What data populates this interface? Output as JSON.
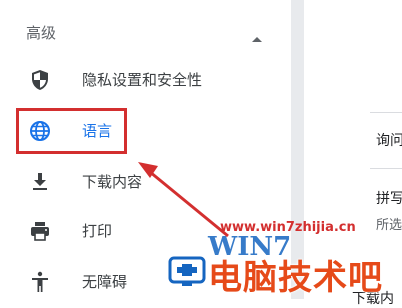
{
  "sidebar": {
    "section_title": "高级",
    "items": [
      {
        "label": "隐私设置和安全性",
        "icon": "shield-icon"
      },
      {
        "label": "语言",
        "icon": "globe-icon"
      },
      {
        "label": "下载内容",
        "icon": "download-icon"
      },
      {
        "label": "打印",
        "icon": "printer-icon"
      },
      {
        "label": "无障碍",
        "icon": "accessibility-icon"
      }
    ]
  },
  "content": {
    "row1": "询问",
    "row2": "拼写",
    "row2_sub": "所选",
    "row3": "下载内"
  },
  "watermark": {
    "url": "www.win7zhijia.cn",
    "logo": "WIN7",
    "brand": "电脑技术吧"
  },
  "colors": {
    "accent": "#1a73e8",
    "highlight": "#d32f2f",
    "brand": "#e64a19"
  }
}
